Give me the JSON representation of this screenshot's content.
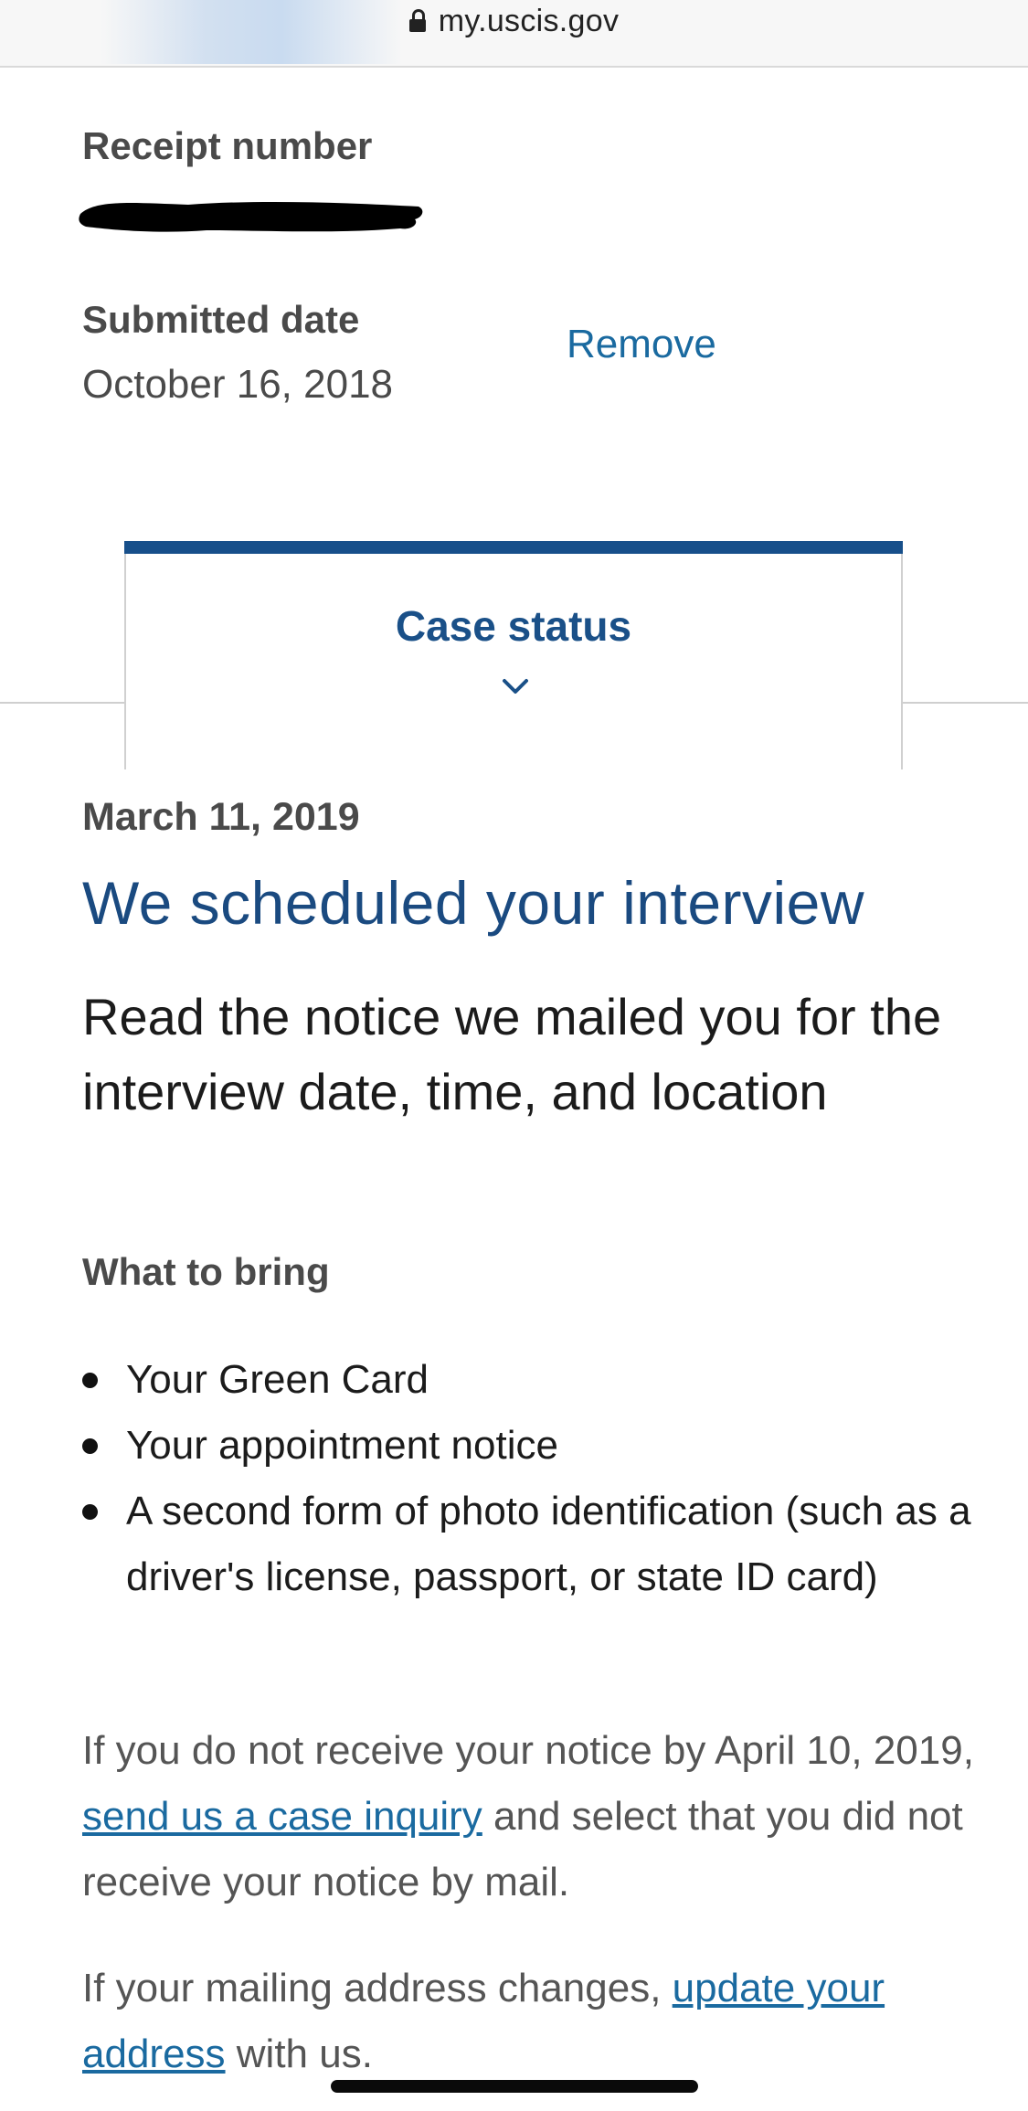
{
  "browser": {
    "url": "my.uscis.gov"
  },
  "case": {
    "receipt_label": "Receipt number",
    "submitted_label": "Submitted date",
    "submitted_date": "October 16, 2018",
    "remove_label": "Remove"
  },
  "tab": {
    "title": "Case status"
  },
  "status": {
    "date": "March 11, 2019",
    "headline": "We scheduled your interview",
    "lead": "Read the notice we mailed you for the interview date, time, and location",
    "bring_heading": "What to bring",
    "bring_items": [
      "Your Green Card",
      "Your appointment notice",
      "A second form of photo identification (such as a driver's license, passport, or state ID card)"
    ],
    "inquiry": {
      "before": "If you do not receive your notice by April 10, 2019, ",
      "link": "send us a case inquiry",
      "after": " and select that you did not receive your notice by mail."
    },
    "address": {
      "before": "If your mailing address changes, ",
      "link": "update your address",
      "after": " with us."
    }
  },
  "colors": {
    "heading_blue": "#1a4a80",
    "link_blue": "#1a6aa0",
    "tab_accent": "#174f8a"
  }
}
